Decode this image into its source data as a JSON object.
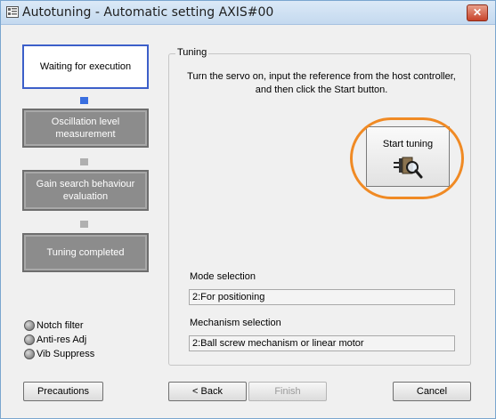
{
  "window": {
    "title": "Autotuning - Automatic setting AXIS#00",
    "close_label": "✕"
  },
  "steps": [
    {
      "label": "Waiting for execution",
      "state": "active"
    },
    {
      "label": "Oscillation level measurement",
      "state": "pending"
    },
    {
      "label": "Gain search behaviour evaluation",
      "state": "pending"
    },
    {
      "label": "Tuning completed",
      "state": "pending"
    }
  ],
  "indicators": [
    {
      "label": "Notch filter",
      "icon": "status-dot-icon"
    },
    {
      "label": "Anti-res Adj",
      "icon": "status-dot-icon"
    },
    {
      "label": "Vib Suppress",
      "icon": "status-dot-icon"
    }
  ],
  "tuning": {
    "group_label": "Tuning",
    "instruction": "Turn the servo on, input the reference from the host controller, and then click the Start button.",
    "start_button_label": "Start tuning",
    "start_button_icon": "servo-magnifier-icon",
    "mode_label": "Mode selection",
    "mode_value": "2:For positioning",
    "mechanism_label": "Mechanism selection",
    "mechanism_value": "2:Ball screw mechanism or linear motor"
  },
  "buttons": {
    "precautions": "Precautions",
    "back": "< Back",
    "finish": "Finish",
    "cancel": "Cancel"
  },
  "colors": {
    "highlight": "#f08a24",
    "active_step_border": "#3c5fc9",
    "active_connector": "#3a6fe0"
  }
}
